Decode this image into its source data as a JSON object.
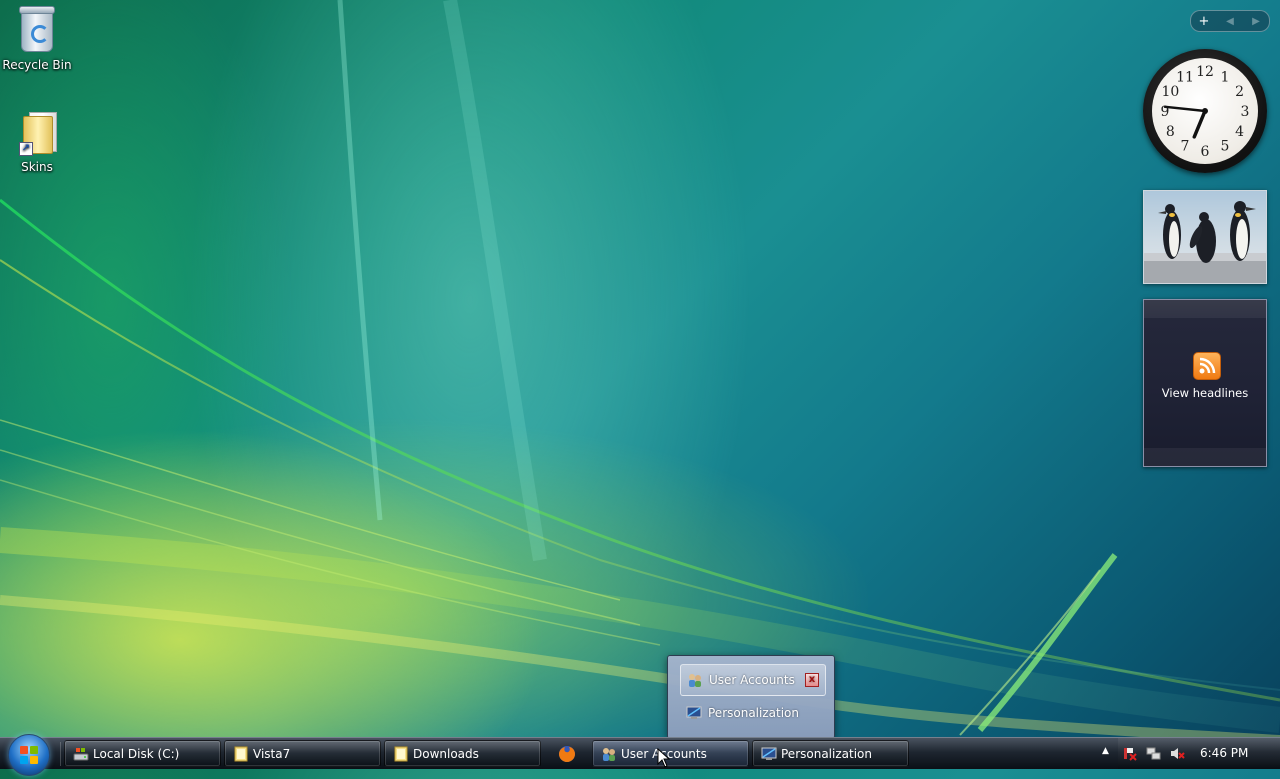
{
  "desktop": {
    "icons": [
      {
        "label": "Recycle Bin",
        "icon": "recycle-bin-icon"
      },
      {
        "label": "Skins",
        "icon": "folder-shortcut-icon"
      }
    ]
  },
  "sidebar": {
    "controls": {
      "add": "+",
      "prev": "◀",
      "next": "▶"
    },
    "clock": {
      "numbers": [
        "12",
        "1",
        "2",
        "3",
        "4",
        "5",
        "6",
        "7",
        "8",
        "9",
        "10",
        "11"
      ],
      "hour": 6.75,
      "minute": 46
    },
    "feed": {
      "label": "View headlines",
      "icon": "rss-icon"
    }
  },
  "popup": {
    "items": [
      {
        "label": "User Accounts",
        "icon": "user-accounts-icon",
        "selected": true
      },
      {
        "label": "Personalization",
        "icon": "personalization-icon",
        "selected": false
      }
    ],
    "close": "x"
  },
  "taskbar": {
    "buttons": [
      {
        "label": "Local Disk (C:)",
        "icon": "drive-icon"
      },
      {
        "label": "Vista7",
        "icon": "folder-icon"
      },
      {
        "label": "Downloads",
        "icon": "folder-icon"
      },
      {
        "label": "User Accounts",
        "icon": "user-accounts-icon",
        "active": true
      },
      {
        "label": "Personalization",
        "icon": "personalization-icon"
      }
    ],
    "quicklaunch": {
      "icon": "firefox-icon"
    },
    "tray": {
      "time": "6:46 PM",
      "show_hidden": "▲"
    }
  },
  "colors": {
    "accent": "#1f6fc6",
    "rss": "#f07a12"
  }
}
